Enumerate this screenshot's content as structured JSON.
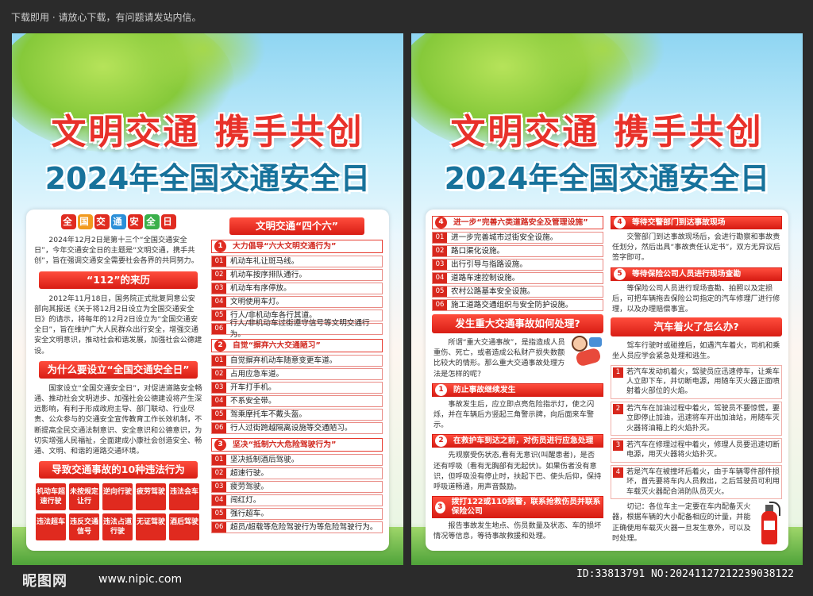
{
  "top_note": "下载即用 · 请放心下载，有问题请发站内信。",
  "poster": {
    "title1": "文明交通  携手共创",
    "title2": "2024年全国交通安全日"
  },
  "left": {
    "tag_chars": [
      "全",
      "国",
      "交",
      "通",
      "安",
      "全",
      "日"
    ],
    "intro": "2024年12月2日是第十三个“全国交通安全日”，今年交通安全日的主题是“文明交通，携手共创”，旨在强调交通安全需要社会各界的共同努力。",
    "h112": "“112”的来历",
    "p112": "2012年11月18日，国务院正式批复同意公安部向其报送《关于将12月2日设立为全国交通安全日》的请示，将每年的12月2日设立为“全国交通安全日”，旨在维护广大人民群众出行安全，增强交通安全文明意识，推动社会和谐发展，加强社会公德建设。",
    "hwhy": "为什么要设立“全国交通安全日”",
    "pwhy": "国家设立“全国交通安全日”，对促进道路安全畅通、推动社会文明进步、加强社会公德建设将产生深远影响，有利于形成政府主导、部门联动、行业尽责、公众参与的交通安全宣传教育工作长效机制，不断提高全民交通法制意识、安全意识和公德意识，为切实增强人民福祉，全面建成小康社会创造安全、畅通、文明、和谐的道路交通环境。",
    "h10": "导致交通事故的10种违法行为",
    "ten": [
      "机动车超速行驶",
      "未按规定让行",
      "逆向行驶",
      "疲劳驾驶",
      "违法会车",
      "违法超车",
      "违反交通信号",
      "违法占道行驶",
      "无证驾驶",
      "酒后驾驶"
    ],
    "hfour": "文明交通“四个六”",
    "s1": {
      "n": "1",
      "title": "大力倡导“六大文明交通行为”",
      "items": [
        "机动车礼让斑马线。",
        "机动车按序排队通行。",
        "机动车有序停放。",
        "文明使用车灯。",
        "行人/非机动车各行其道。",
        "行人/非机动车过街遵守信号等文明交通行为。"
      ]
    },
    "s2": {
      "n": "2",
      "title": "自觉“摒弃六大交通陋习”",
      "items": [
        "自觉摒弃机动车随意变更车道。",
        "占用应急车道。",
        "开车打手机。",
        "不系安全带。",
        "驾乘摩托车不戴头盔。",
        "行人过街跨越隔离设施等交通陋习。"
      ]
    },
    "s3": {
      "n": "3",
      "title": "坚决“抵制六大危险驾驶行为”",
      "items": [
        "坚决抵制酒后驾驶。",
        "超速行驶。",
        "疲劳驾驶。",
        "闯红灯。",
        "强行超车。",
        "超员/超载等危险驾驶行为等危险驾驶行为。"
      ]
    }
  },
  "right": {
    "s4": {
      "n": "4",
      "title": "进一步“完善六类道路安全及管理设施”",
      "items": [
        "进一步完善城市过街安全设施。",
        "路口渠化设施。",
        "出行引导与指路设施。",
        "道路车速控制设施。",
        "农村公路基本安全设施。",
        "施工道路交通组织与安全防护设施。"
      ]
    },
    "hacc": "发生重大交通事故如何处理?",
    "pacc": "所谓“重大交通事故”，是指造成人员重伤、死亡，或者造成公私财产损失数额比较大的情形。那么重大交通事故处理方法是怎样的呢？",
    "a1": {
      "title": "防止事故继续发生",
      "text": "事故发生后，应立即点亮危险指示灯，使之闪烁，并在车辆后方竖起三角警示牌，向后面来车警示。"
    },
    "a2": {
      "title": "在救护车到达之前，对伤员进行应急处理",
      "text": "先观察受伤状态,看有无意识(叫醒患者)，是否还有呼吸（看有无胸部有无起伏)。如果伤者没有意识，但呼吸没有停止时，扶起下巴、使头后仰，保持呼吸道畅通，用声音鼓励。"
    },
    "a3": {
      "title": "拨打122或110报警，联系抢救伤员并联系保险公司",
      "text": "报告事故发生地点、伤员数量及状态、车的损坏情况等信息，等待事故救援和处理。"
    },
    "p1": {
      "title": "等待交警部门到达事故现场",
      "text": "交警部门到达事故现场后，会进行勘察和事故责任划分，然后出具“事故责任认定书”，双方无异议后签字即可。"
    },
    "p2": {
      "title": "等待保险公司人员进行现场查勘",
      "text": "等保险公司人员进行现场查勘、拍照以及定损后，可把车辆拖去保险公司指定的汽车修理厂进行修理，以及办理赔偿事宜。"
    },
    "hfire": "汽车着火了怎么办?",
    "pfire": "驾车行驶时或碰撞后，如遇汽车着火，司机和乘坐人员应学会紧急处理和逃生。",
    "fires": [
      {
        "n": "1",
        "text": "若汽车发动机着火，驾驶员应迅速停车，让乘车人立即下车，并切断电源，用随车灭火器正面喷射着火部位的火焰。"
      },
      {
        "n": "2",
        "text": "若汽车在加油过程中着火，驾驶员不要惊慌，要立即停止加油，迅速将车开出加油站，用随车灭火器将油箱上的火焰扑灭。"
      },
      {
        "n": "3",
        "text": "若汽车在修理过程中着火，修理人员要迅速切断电源，用灭火器将火焰扑灭。"
      },
      {
        "n": "4",
        "text": "若是汽车在被撞坏后着火，由于车辆零件部件损坏，首先要将车内人员救出，之后驾驶员可利用车载灭火器配合消防队员灭火。"
      }
    ],
    "remind": "切记：各位车主一定要在车内配备灭火器，根据车辆的大小配备相应的计量，并能正确使用车载灭火器一旦发生意外，可以及时处理。"
  },
  "footer": {
    "logo": "昵图网",
    "url": "www.nipic.com",
    "ids": "ID:33813791 NO:20241127212239038122"
  }
}
